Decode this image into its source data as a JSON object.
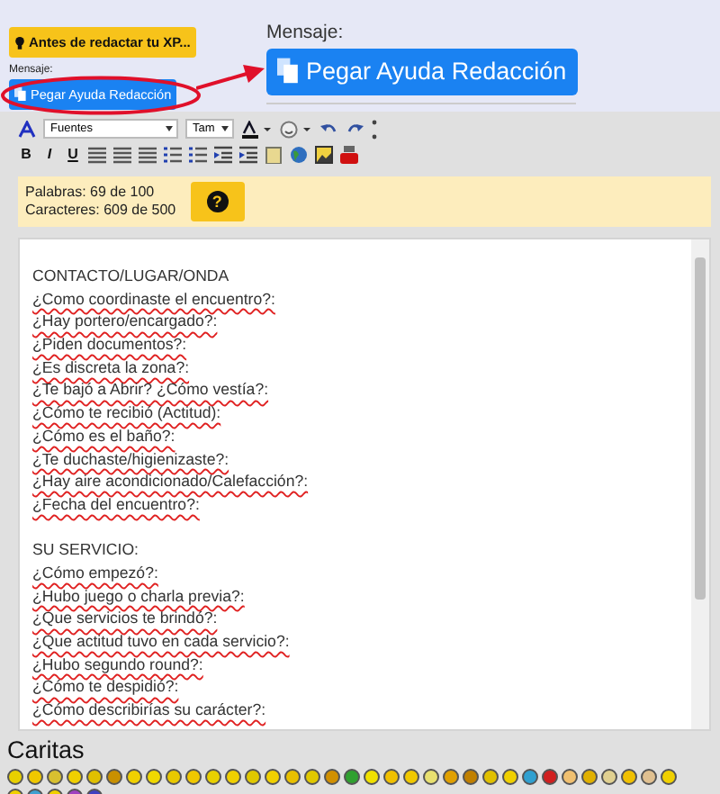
{
  "tip_button": {
    "label": "Antes de redactar tu XP..."
  },
  "small_panel": {
    "label": "Mensaje:",
    "button": "Pegar Ayuda Redacción"
  },
  "callout": {
    "label": "Mensaje:",
    "button": "Pegar Ayuda Redacción"
  },
  "toolbar": {
    "font_select": "Fuentes",
    "size_select": "Tam",
    "format_buttons": [
      "B",
      "I",
      "U"
    ]
  },
  "counter": {
    "words": "Palabras: 69 de 100",
    "chars": "Caracteres: 609 de 500",
    "help": "?"
  },
  "editor_lines": [
    {
      "kind": "heading",
      "text": "CONTACTO/LUGAR/ONDA"
    },
    {
      "kind": "question",
      "text": "¿Como coordinaste el encuentro?:"
    },
    {
      "kind": "question",
      "text": "¿Hay portero/encargado?:"
    },
    {
      "kind": "question",
      "text": "¿Piden documentos?:"
    },
    {
      "kind": "question",
      "text": "¿Es discreta la zona?:"
    },
    {
      "kind": "question",
      "text": "¿Te bajó a Abrir? ¿Cómo vestía?:"
    },
    {
      "kind": "question",
      "text": "¿Cómo te recibió (Actitud):"
    },
    {
      "kind": "question",
      "text": "¿Cómo es el baño?:"
    },
    {
      "kind": "question",
      "text": "¿Te duchaste/higienizaste?:"
    },
    {
      "kind": "question",
      "text": "¿Hay aire acondicionado/Calefacción?:"
    },
    {
      "kind": "question",
      "text": "¿Fecha del encuentro?:"
    },
    {
      "kind": "blank"
    },
    {
      "kind": "heading",
      "text": "SU SERVICIO:"
    },
    {
      "kind": "question",
      "text": "¿Cómo empezó?:"
    },
    {
      "kind": "question",
      "text": "¿Hubo juego o charla previa?:"
    },
    {
      "kind": "question",
      "text": "¿Que servicios te brindó?:"
    },
    {
      "kind": "question",
      "text": "¿Que actitud tuvo en cada servicio?:"
    },
    {
      "kind": "question",
      "text": "¿Hubo segundo round?:"
    },
    {
      "kind": "question",
      "text": "¿Cómo te despidió?:"
    },
    {
      "kind": "question",
      "text": "¿Cómo describirías su carácter?:"
    }
  ],
  "emoticons": {
    "title": "Caritas"
  }
}
